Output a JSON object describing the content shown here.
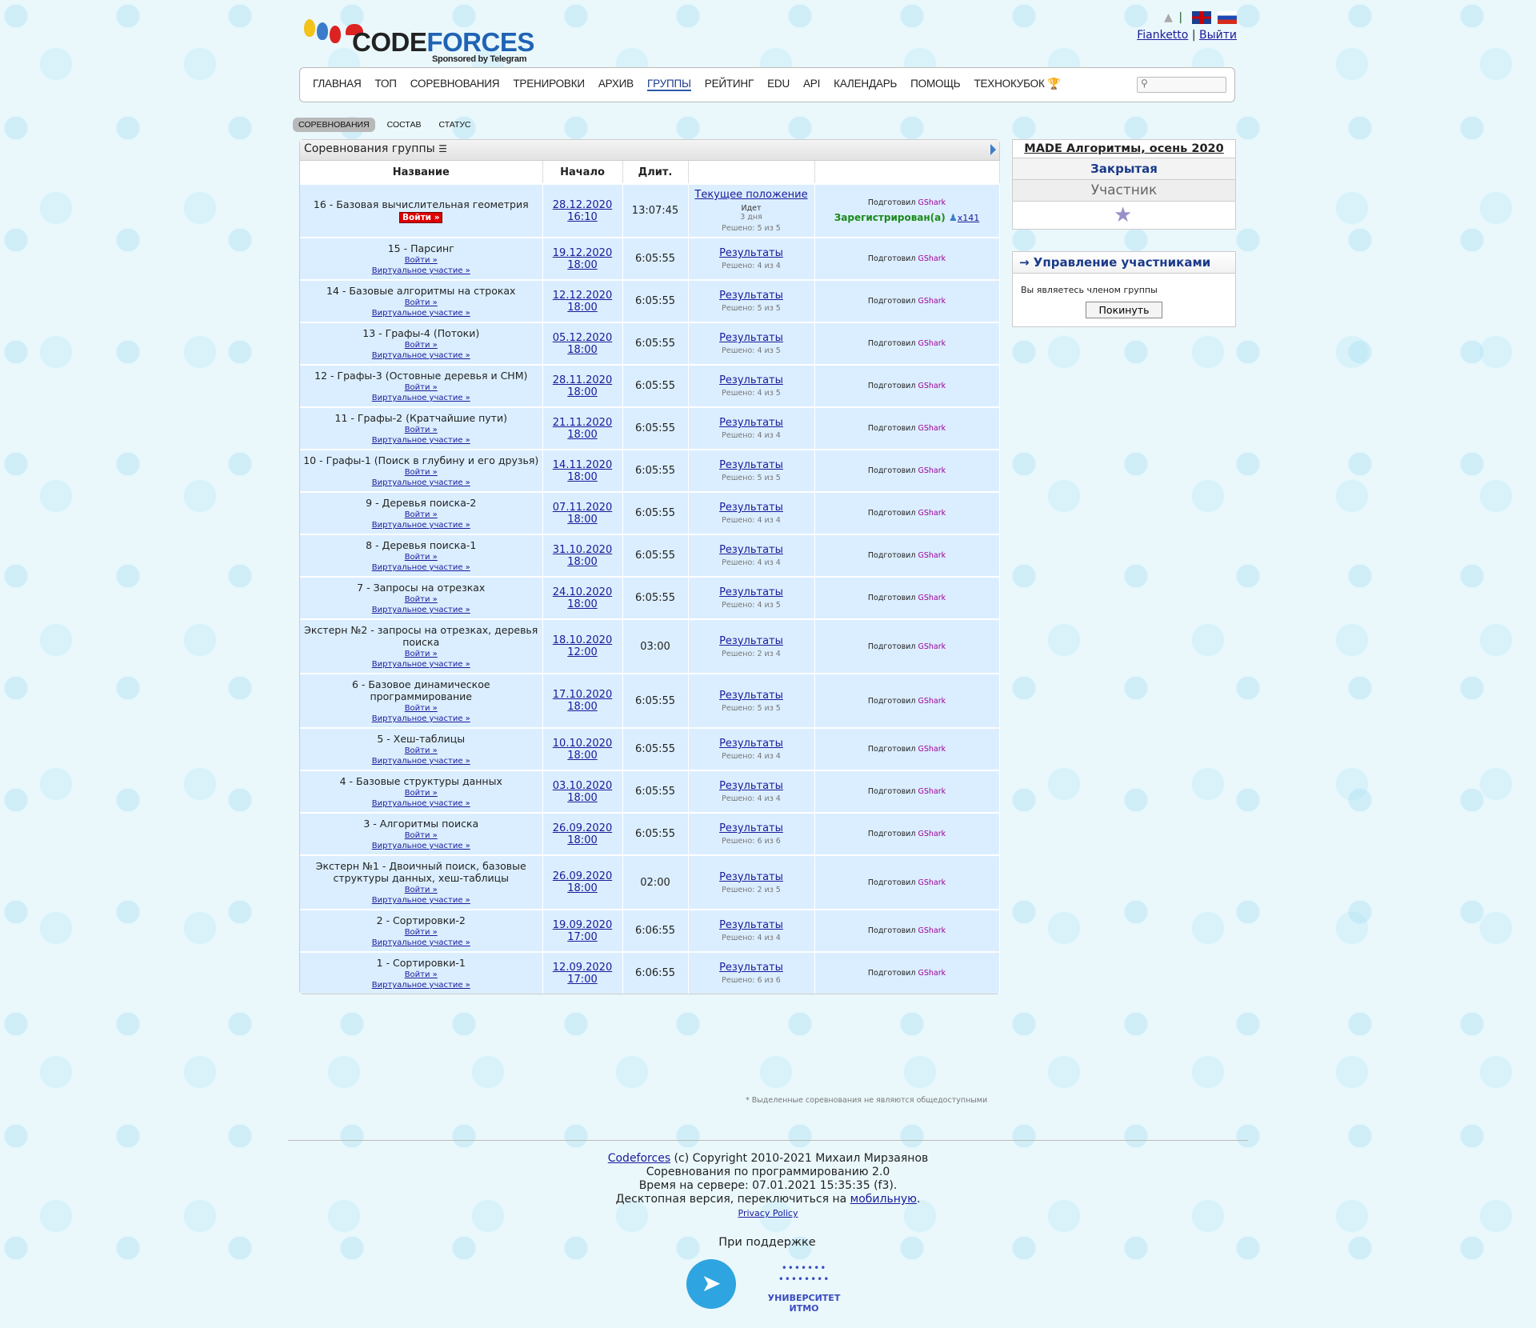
{
  "brand": {
    "name_part1": "CODE",
    "name_part2": "FORCES",
    "sponsor": "Sponsored by Telegram"
  },
  "user": {
    "name": "Fianketto",
    "separator": "|",
    "logout": "Выйти"
  },
  "nav": [
    "ГЛАВНАЯ",
    "ТОП",
    "СОРЕВНОВАНИЯ",
    "ТРЕНИРОВКИ",
    "АРХИВ",
    "ГРУППЫ",
    "РЕЙТИНГ",
    "EDU",
    "API",
    "КАЛЕНДАРЬ",
    "ПОМОЩЬ",
    "ТЕХНОКУБОК"
  ],
  "nav_active": "ГРУППЫ",
  "subtabs": [
    "СОРЕВНОВАНИЯ",
    "СОСТАВ",
    "СТАТУС"
  ],
  "contests_box": {
    "caption": "Соревнования группы",
    "headers": [
      "Название",
      "Начало",
      "Длит.",
      "",
      ""
    ]
  },
  "contests": [
    {
      "name": "16 - Базовая вычислительная геометрия",
      "enter": "Войти »",
      "date": "28.12.2020",
      "time": "16:10",
      "dur": "13:07:45",
      "res": "Текущее положение",
      "status": "Идет",
      "left": "3 дня",
      "solved": "Решено: 5 из 5",
      "author_prefix": "Подготовил",
      "author": "GShark",
      "reg": "Зарегистрирован(а)",
      "regcount": "x141",
      "current": true
    },
    {
      "name": "15 - Парсинг",
      "enter": "Войти »",
      "virt": "Виртуальное участие »",
      "date": "19.12.2020",
      "time": "18:00",
      "dur": "6:05:55",
      "res": "Результаты",
      "solved": "Решено: 4 из 4",
      "author_prefix": "Подготовил",
      "author": "GShark"
    },
    {
      "name": "14 - Базовые алгоритмы на строках",
      "enter": "Войти »",
      "virt": "Виртуальное участие »",
      "date": "12.12.2020",
      "time": "18:00",
      "dur": "6:05:55",
      "res": "Результаты",
      "solved": "Решено: 5 из 5",
      "author_prefix": "Подготовил",
      "author": "GShark"
    },
    {
      "name": "13 - Графы-4 (Потоки)",
      "enter": "Войти »",
      "virt": "Виртуальное участие »",
      "date": "05.12.2020",
      "time": "18:00",
      "dur": "6:05:55",
      "res": "Результаты",
      "solved": "Решено: 4 из 5",
      "author_prefix": "Подготовил",
      "author": "GShark"
    },
    {
      "name": "12 - Графы-3 (Остовные деревья и СНМ)",
      "enter": "Войти »",
      "virt": "Виртуальное участие »",
      "date": "28.11.2020",
      "time": "18:00",
      "dur": "6:05:55",
      "res": "Результаты",
      "solved": "Решено: 4 из 5",
      "author_prefix": "Подготовил",
      "author": "GShark"
    },
    {
      "name": "11 - Графы-2 (Кратчайшие пути)",
      "enter": "Войти »",
      "virt": "Виртуальное участие »",
      "date": "21.11.2020",
      "time": "18:00",
      "dur": "6:05:55",
      "res": "Результаты",
      "solved": "Решено: 4 из 4",
      "author_prefix": "Подготовил",
      "author": "GShark"
    },
    {
      "name": "10 - Графы-1 (Поиск в глубину и его друзья)",
      "enter": "Войти »",
      "virt": "Виртуальное участие »",
      "date": "14.11.2020",
      "time": "18:00",
      "dur": "6:05:55",
      "res": "Результаты",
      "solved": "Решено: 5 из 5",
      "author_prefix": "Подготовил",
      "author": "GShark"
    },
    {
      "name": "9 - Деревья поиска-2",
      "enter": "Войти »",
      "virt": "Виртуальное участие »",
      "date": "07.11.2020",
      "time": "18:00",
      "dur": "6:05:55",
      "res": "Результаты",
      "solved": "Решено: 4 из 4",
      "author_prefix": "Подготовил",
      "author": "GShark"
    },
    {
      "name": "8 - Деревья поиска-1",
      "enter": "Войти »",
      "virt": "Виртуальное участие »",
      "date": "31.10.2020",
      "time": "18:00",
      "dur": "6:05:55",
      "res": "Результаты",
      "solved": "Решено: 4 из 4",
      "author_prefix": "Подготовил",
      "author": "GShark"
    },
    {
      "name": "7 - Запросы на отрезках",
      "enter": "Войти »",
      "virt": "Виртуальное участие »",
      "date": "24.10.2020",
      "time": "18:00",
      "dur": "6:05:55",
      "res": "Результаты",
      "solved": "Решено: 4 из 5",
      "author_prefix": "Подготовил",
      "author": "GShark"
    },
    {
      "name": "Экстерн №2 - запросы на отрезках, деревья поиска",
      "enter": "Войти »",
      "virt": "Виртуальное участие »",
      "date": "18.10.2020",
      "time": "12:00",
      "dur": "03:00",
      "res": "Результаты",
      "solved": "Решено: 2 из 4",
      "author_prefix": "Подготовил",
      "author": "GShark"
    },
    {
      "name": "6 - Базовое динамическое программирование",
      "enter": "Войти »",
      "virt": "Виртуальное участие »",
      "date": "17.10.2020",
      "time": "18:00",
      "dur": "6:05:55",
      "res": "Результаты",
      "solved": "Решено: 5 из 5",
      "author_prefix": "Подготовил",
      "author": "GShark"
    },
    {
      "name": "5 - Хеш-таблицы",
      "enter": "Войти »",
      "virt": "Виртуальное участие »",
      "date": "10.10.2020",
      "time": "18:00",
      "dur": "6:05:55",
      "res": "Результаты",
      "solved": "Решено: 4 из 4",
      "author_prefix": "Подготовил",
      "author": "GShark"
    },
    {
      "name": "4 - Базовые структуры данных",
      "enter": "Войти »",
      "virt": "Виртуальное участие »",
      "date": "03.10.2020",
      "time": "18:00",
      "dur": "6:05:55",
      "res": "Результаты",
      "solved": "Решено: 4 из 4",
      "author_prefix": "Подготовил",
      "author": "GShark"
    },
    {
      "name": "3 - Алгоритмы поиска",
      "enter": "Войти »",
      "virt": "Виртуальное участие »",
      "date": "26.09.2020",
      "time": "18:00",
      "dur": "6:05:55",
      "res": "Результаты",
      "solved": "Решено: 6 из 6",
      "author_prefix": "Подготовил",
      "author": "GShark"
    },
    {
      "name": "Экстерн №1 - Двоичный поиск, базовые структуры данных, хеш-таблицы",
      "enter": "Войти »",
      "virt": "Виртуальное участие »",
      "date": "26.09.2020",
      "time": "18:00",
      "dur": "02:00",
      "res": "Результаты",
      "solved": "Решено: 2 из 5",
      "author_prefix": "Подготовил",
      "author": "GShark"
    },
    {
      "name": "2 - Сортировки-2",
      "enter": "Войти »",
      "virt": "Виртуальное участие »",
      "date": "19.09.2020",
      "time": "17:00",
      "dur": "6:06:55",
      "res": "Результаты",
      "solved": "Решено: 4 из 4",
      "author_prefix": "Подготовил",
      "author": "GShark"
    },
    {
      "name": "1 - Сортировки-1",
      "enter": "Войти »",
      "virt": "Виртуальное участие »",
      "date": "12.09.2020",
      "time": "17:00",
      "dur": "6:06:55",
      "res": "Результаты",
      "solved": "Решено: 6 из 6",
      "author_prefix": "Подготовил",
      "author": "GShark"
    }
  ],
  "note": "* Выделенные соревнования не являются общедоступными",
  "group": {
    "title": "MADE Алгоритмы, осень 2020",
    "type": "Закрытая",
    "role": "Участник"
  },
  "manage": {
    "title": "→ Управление участниками",
    "text": "Вы являетесь членом группы",
    "button": "Покинуть"
  },
  "footer": {
    "link": "Codeforces",
    "copy": " (c) Copyright 2010-2021 Михаил Мирзаянов",
    "line2": "Соревнования по программированию 2.0",
    "line3": "Время на сервере: 07.01.2021 15:35:35 (f3).",
    "line4": "Десктопная версия, переключиться на ",
    "mobile": "мобильную",
    "privacy": "Privacy Policy",
    "support": "При поддержке",
    "itmo": "УНИВЕРСИТЕТ ИТМО"
  },
  "colors": {
    "row": "#dbeeff",
    "author": "#a0009a",
    "registered": "#1a8a1a",
    "link": "#1a1a9a"
  }
}
